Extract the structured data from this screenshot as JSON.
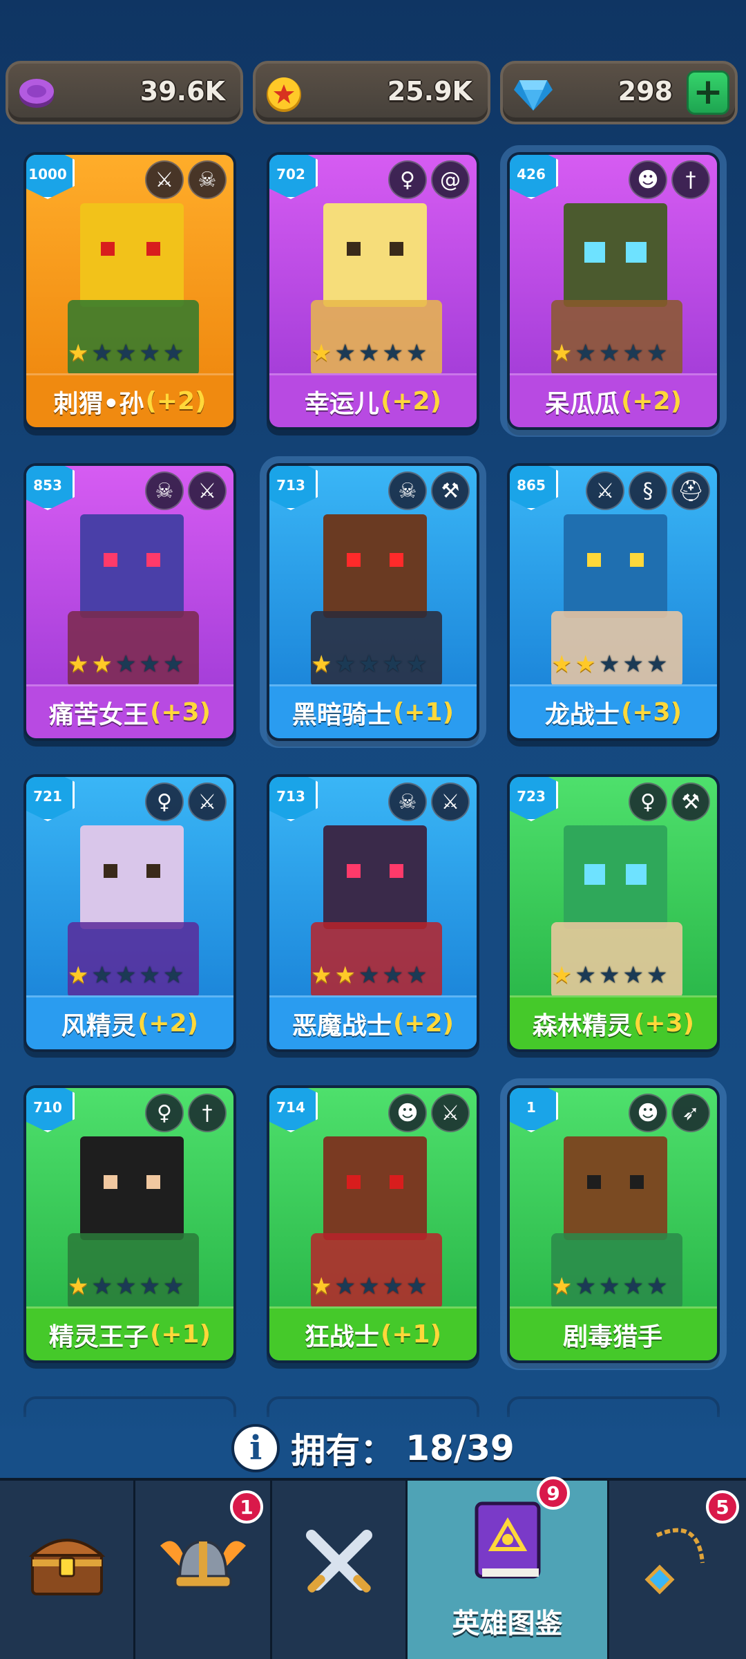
{
  "currencies": [
    {
      "name": "purple-coin",
      "value": "39.6K"
    },
    {
      "name": "gold-coin",
      "value": "25.9K"
    },
    {
      "name": "gems",
      "value": "298"
    }
  ],
  "colors": {
    "background": "#15487e",
    "orange_card": "#f08a10",
    "purple_card": "#b84ae2",
    "blue_card": "#2a9cf0",
    "green_card": "#45c92a",
    "bonus_text": "#ffd83a",
    "star_on": "#ffc928",
    "active_tab": "#4fa3b6"
  },
  "heroes": [
    {
      "power": "1000",
      "name": "刺猬•孙",
      "bonus": "(+2)",
      "stars": 1,
      "theme": "orange",
      "traits": [
        "sword-icon",
        "skull-icon"
      ]
    },
    {
      "power": "702",
      "name": "幸运儿",
      "bonus": "(+2)",
      "stars": 1,
      "theme": "purple",
      "traits": [
        "elf-icon",
        "swirl-icon"
      ]
    },
    {
      "power": "426",
      "name": "呆瓜瓜",
      "bonus": "(+2)",
      "stars": 1,
      "theme": "purple",
      "traits": [
        "orc-icon",
        "dagger-icon"
      ]
    },
    {
      "power": "853",
      "name": "痛苦女王",
      "bonus": "(+3)",
      "stars": 2,
      "theme": "purple",
      "traits": [
        "skull-icon",
        "sword-icon"
      ]
    },
    {
      "power": "713",
      "name": "黑暗骑士",
      "bonus": "(+1)",
      "stars": 1,
      "theme": "blue",
      "traits": [
        "skull-icon",
        "hammer-icon"
      ]
    },
    {
      "power": "865",
      "name": "龙战士",
      "bonus": "(+3)",
      "stars": 2,
      "theme": "blue",
      "traits": [
        "sword-icon",
        "dragon-icon",
        "helmet-icon"
      ]
    },
    {
      "power": "721",
      "name": "风精灵",
      "bonus": "(+2)",
      "stars": 1,
      "theme": "blue",
      "traits": [
        "elf-icon",
        "sword-icon"
      ]
    },
    {
      "power": "713",
      "name": "恶魔战士",
      "bonus": "(+2)",
      "stars": 2,
      "theme": "blue",
      "traits": [
        "skull-icon",
        "sword-icon"
      ]
    },
    {
      "power": "723",
      "name": "森林精灵",
      "bonus": "(+3)",
      "stars": 1,
      "theme": "green",
      "traits": [
        "elf-icon",
        "hammer-icon"
      ]
    },
    {
      "power": "710",
      "name": "精灵王子",
      "bonus": "(+1)",
      "stars": 1,
      "theme": "green",
      "traits": [
        "elf-icon",
        "dagger-icon"
      ]
    },
    {
      "power": "714",
      "name": "狂战士",
      "bonus": "(+1)",
      "stars": 1,
      "theme": "green",
      "traits": [
        "orc-icon",
        "sword-icon"
      ]
    },
    {
      "power": "1",
      "name": "剧毒猎手",
      "bonus": "",
      "stars": 1,
      "theme": "green",
      "traits": [
        "orc-icon",
        "bow-icon"
      ]
    }
  ],
  "owned": {
    "label": "拥有：",
    "count": "18/39"
  },
  "nav": {
    "tabs": [
      {
        "name": "chest",
        "icon": "chest-icon",
        "badge": ""
      },
      {
        "name": "heroes-helmet",
        "icon": "viking-helmet-icon",
        "badge": "1"
      },
      {
        "name": "battle",
        "icon": "crossed-swords-icon",
        "badge": ""
      },
      {
        "name": "codex",
        "icon": "spellbook-icon",
        "label": "英雄图鉴",
        "badge": "9"
      },
      {
        "name": "amulet",
        "icon": "amulet-icon",
        "badge": "5"
      }
    ]
  }
}
